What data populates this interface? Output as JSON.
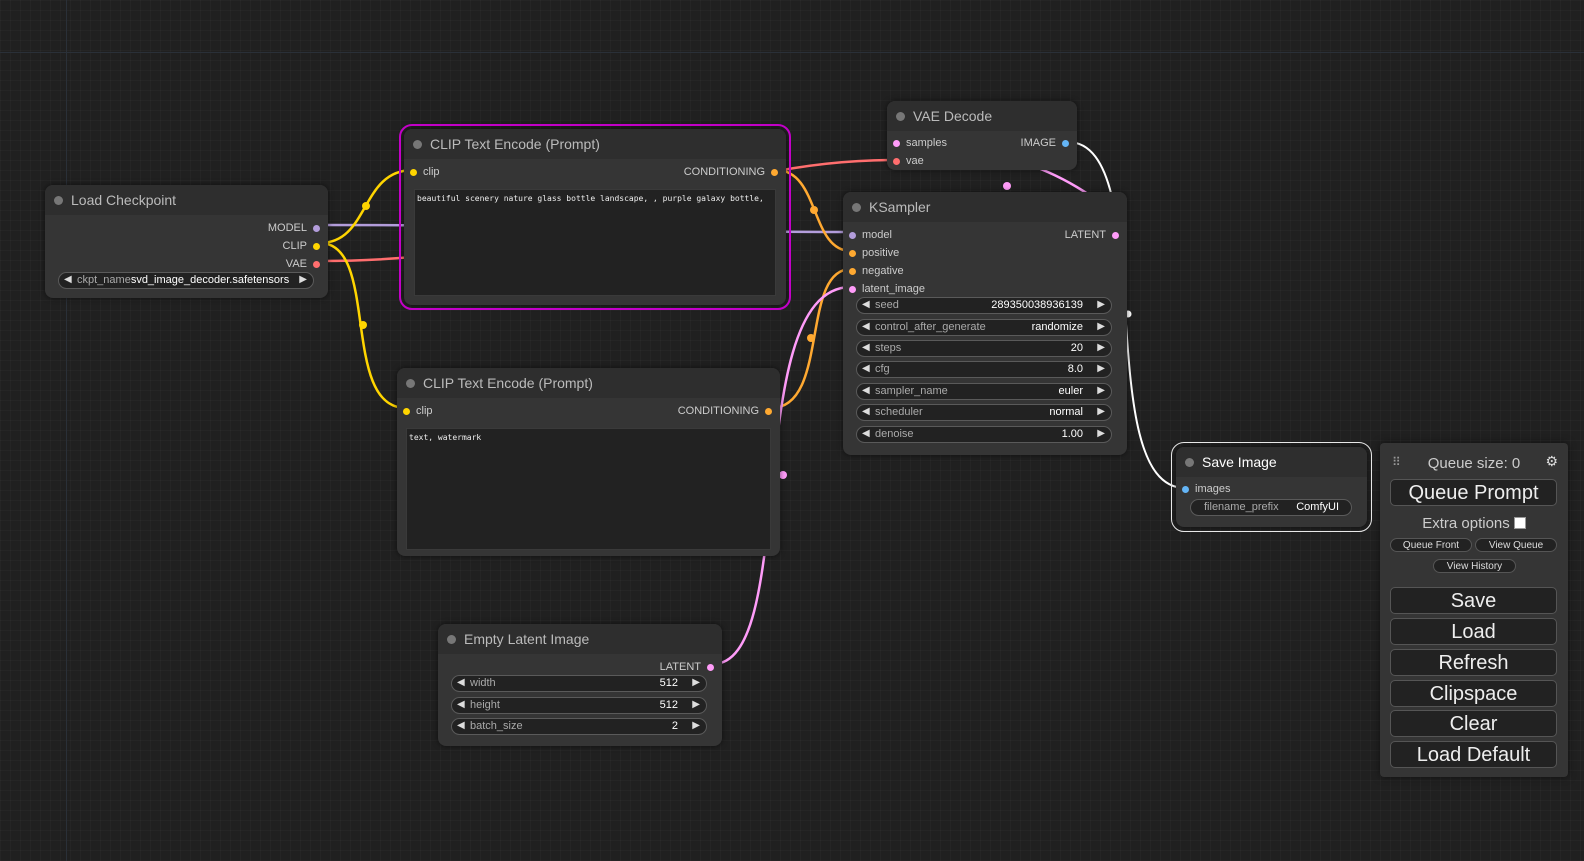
{
  "load_checkpoint": {
    "title": "Load Checkpoint",
    "outputs": [
      "MODEL",
      "CLIP",
      "VAE"
    ],
    "ckpt_label": "ckpt_name",
    "ckpt_value": "svd_image_decoder.safetensors"
  },
  "clip_pos": {
    "title": "CLIP Text Encode (Prompt)",
    "input": "clip",
    "output": "CONDITIONING",
    "text": "beautiful scenery nature glass bottle landscape, , purple galaxy bottle,"
  },
  "clip_neg": {
    "title": "CLIP Text Encode (Prompt)",
    "input": "clip",
    "output": "CONDITIONING",
    "text": "text, watermark"
  },
  "vae_decode": {
    "title": "VAE Decode",
    "inputs": [
      "samples",
      "vae"
    ],
    "output": "IMAGE"
  },
  "ksampler": {
    "title": "KSampler",
    "inputs": [
      "model",
      "positive",
      "negative",
      "latent_image"
    ],
    "output": "LATENT",
    "widgets": [
      {
        "label": "seed",
        "value": "289350038936139"
      },
      {
        "label": "control_after_generate",
        "value": "randomize"
      },
      {
        "label": "steps",
        "value": "20"
      },
      {
        "label": "cfg",
        "value": "8.0"
      },
      {
        "label": "sampler_name",
        "value": "euler"
      },
      {
        "label": "scheduler",
        "value": "normal"
      },
      {
        "label": "denoise",
        "value": "1.00"
      }
    ]
  },
  "save_image": {
    "title": "Save Image",
    "input": "images",
    "prefix_label": "filename_prefix",
    "prefix_value": "ComfyUI"
  },
  "empty_latent": {
    "title": "Empty Latent Image",
    "output": "LATENT",
    "widgets": [
      {
        "label": "width",
        "value": "512"
      },
      {
        "label": "height",
        "value": "512"
      },
      {
        "label": "batch_size",
        "value": "2"
      }
    ]
  },
  "panel": {
    "queue_size": "Queue size: 0",
    "queue_prompt": "Queue Prompt",
    "extra_options": "Extra options",
    "queue_front": "Queue Front",
    "view_queue": "View Queue",
    "view_history": "View History",
    "save": "Save",
    "load": "Load",
    "refresh": "Refresh",
    "clipspace": "Clipspace",
    "clear": "Clear",
    "load_default": "Load Default"
  },
  "colors": {
    "clip": "#ffd500",
    "conditioning": "#ffa931",
    "model": "#b39ddb",
    "vae": "#ff6e6e",
    "latent": "#ff9cf9",
    "image": "#64b5f6",
    "selected_outline": "#c300c8"
  }
}
